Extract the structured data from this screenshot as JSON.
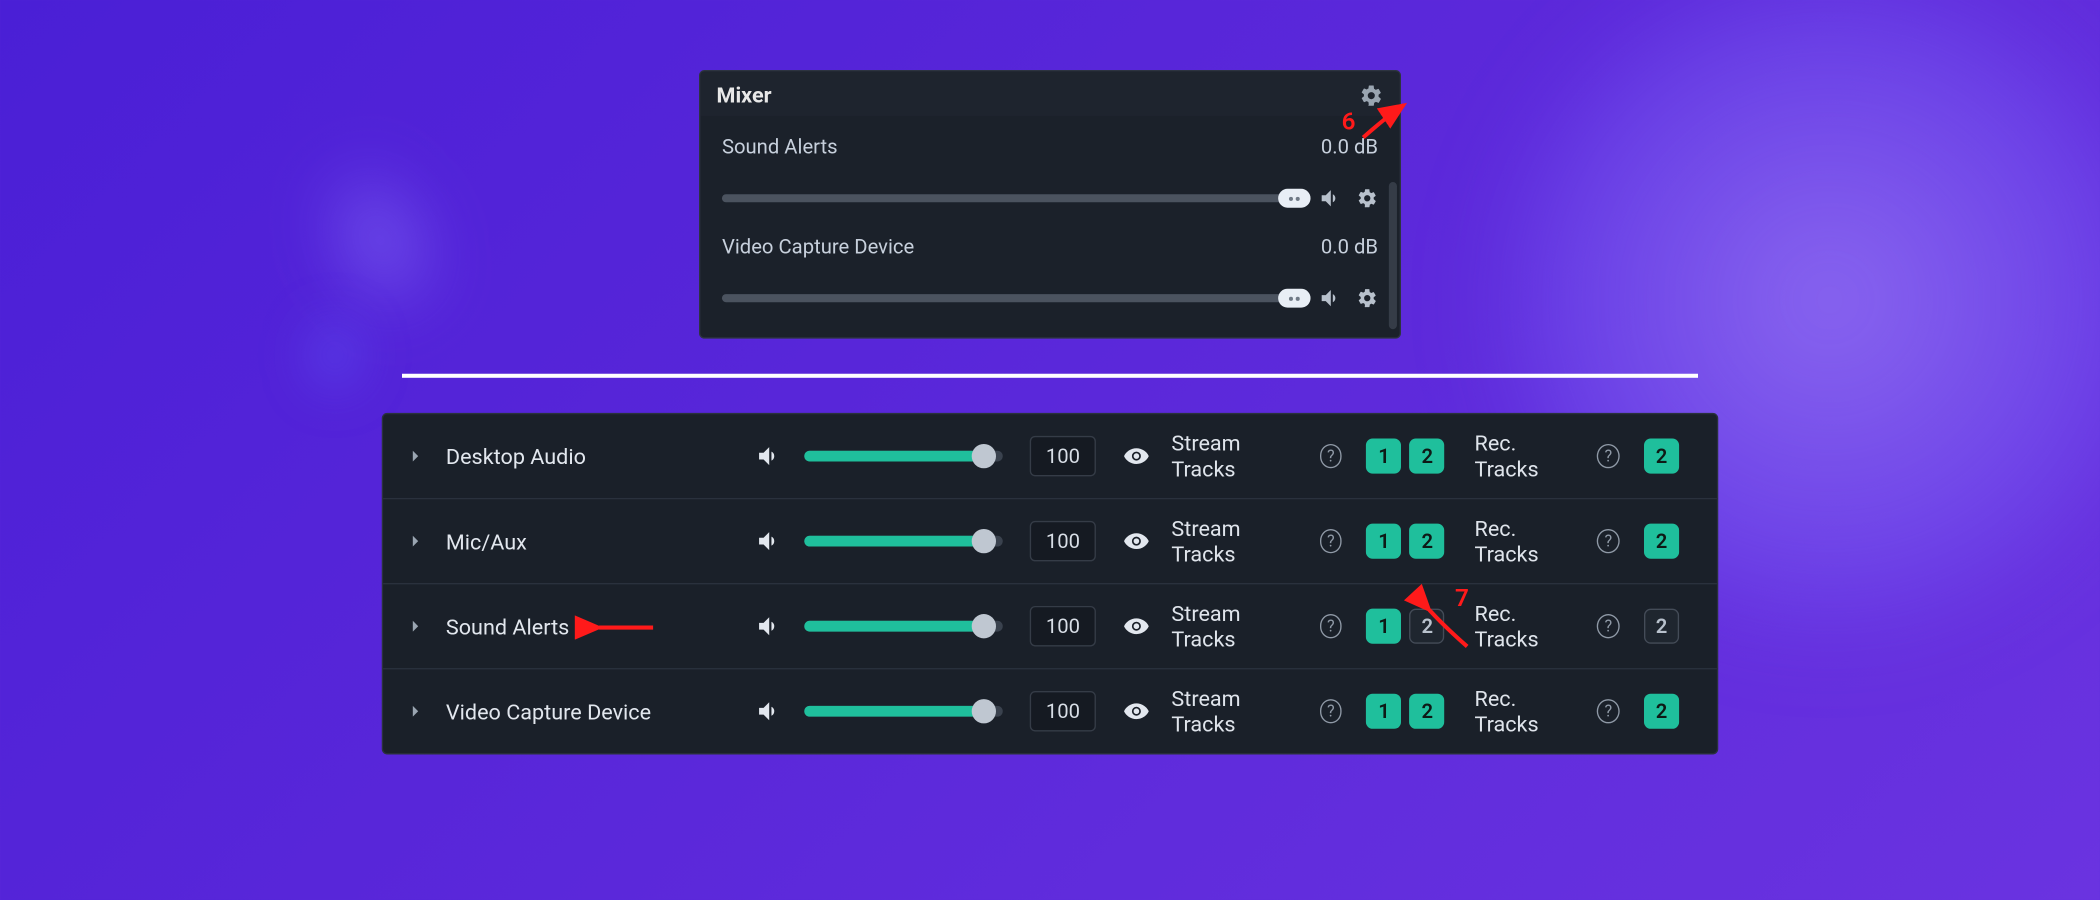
{
  "mixer": {
    "title": "Mixer",
    "rows": [
      {
        "name": "Sound Alerts",
        "db": "0.0 dB"
      },
      {
        "name": "Video Capture Device",
        "db": "0.0 dB"
      }
    ]
  },
  "advanced": {
    "stream_label": "Stream Tracks",
    "rec_label": "Rec. Tracks",
    "rows": [
      {
        "name": "Desktop Audio",
        "volume": 100,
        "slider_pct": 90,
        "stream_tracks": [
          {
            "n": "1",
            "on": true
          },
          {
            "n": "2",
            "on": true
          }
        ],
        "rec_tracks": [
          {
            "n": "2",
            "on": true
          }
        ]
      },
      {
        "name": "Mic/Aux",
        "volume": 100,
        "slider_pct": 90,
        "stream_tracks": [
          {
            "n": "1",
            "on": true
          },
          {
            "n": "2",
            "on": true
          }
        ],
        "rec_tracks": [
          {
            "n": "2",
            "on": true
          }
        ]
      },
      {
        "name": "Sound Alerts",
        "volume": 100,
        "slider_pct": 90,
        "stream_tracks": [
          {
            "n": "1",
            "on": true
          },
          {
            "n": "2",
            "on": false
          }
        ],
        "rec_tracks": [
          {
            "n": "2",
            "on": false
          }
        ]
      },
      {
        "name": "Video Capture Device",
        "volume": 100,
        "slider_pct": 90,
        "stream_tracks": [
          {
            "n": "1",
            "on": true
          },
          {
            "n": "2",
            "on": true
          }
        ],
        "rec_tracks": [
          {
            "n": "2",
            "on": true
          }
        ]
      }
    ]
  },
  "annotations": {
    "a6": "6",
    "a7": "7"
  }
}
